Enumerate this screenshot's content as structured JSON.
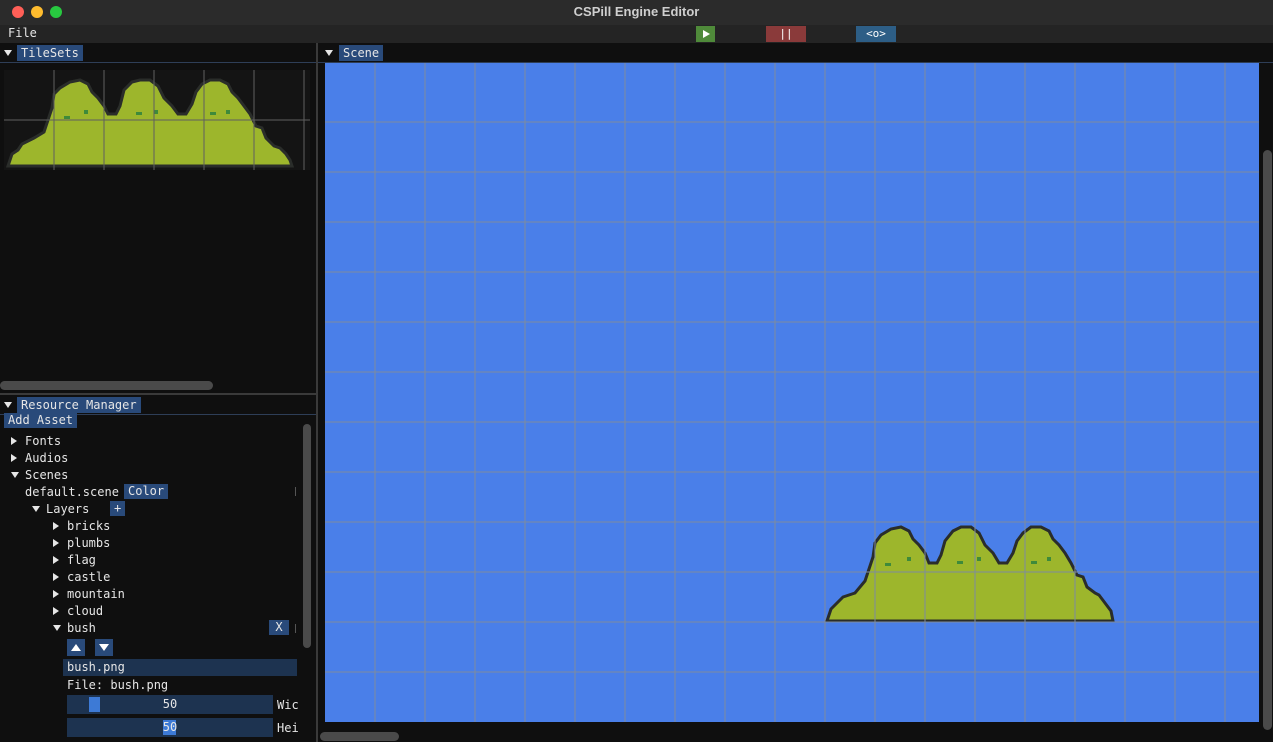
{
  "window": {
    "title": "CSPill Engine Editor"
  },
  "menu": {
    "file": "File"
  },
  "toolbar": {
    "play_icon": "play-icon",
    "pause_label": "||",
    "stop_label": "<o>",
    "colors": {
      "play": "#4f8a3a",
      "pause": "#8a3a3a",
      "stop": "#2d5e86"
    }
  },
  "tilesets": {
    "title": "TileSets"
  },
  "resource_manager": {
    "title": "Resource Manager",
    "add_asset_label": "Add Asset",
    "tree": {
      "fonts": "Fonts",
      "audios": "Audios",
      "scenes": "Scenes",
      "scene_name": "default.scene",
      "color_button": "Color",
      "layers": "Layers",
      "add_layer": "+",
      "layer_items": [
        "bricks",
        "plumbs",
        "flag",
        "castle",
        "mountain",
        "cloud"
      ],
      "selected_layer": "bush",
      "remove_label": "X"
    },
    "bush": {
      "asset_name": "bush.png",
      "file_label": "File: bush.png",
      "width_value": "50",
      "width_label": "Wic",
      "height_value": "50",
      "height_label": "Hei"
    }
  },
  "scene": {
    "title": "Scene",
    "background": "#4a7fe9",
    "grid_color": "#7d8ba0",
    "bush_color": "#9db62c"
  }
}
